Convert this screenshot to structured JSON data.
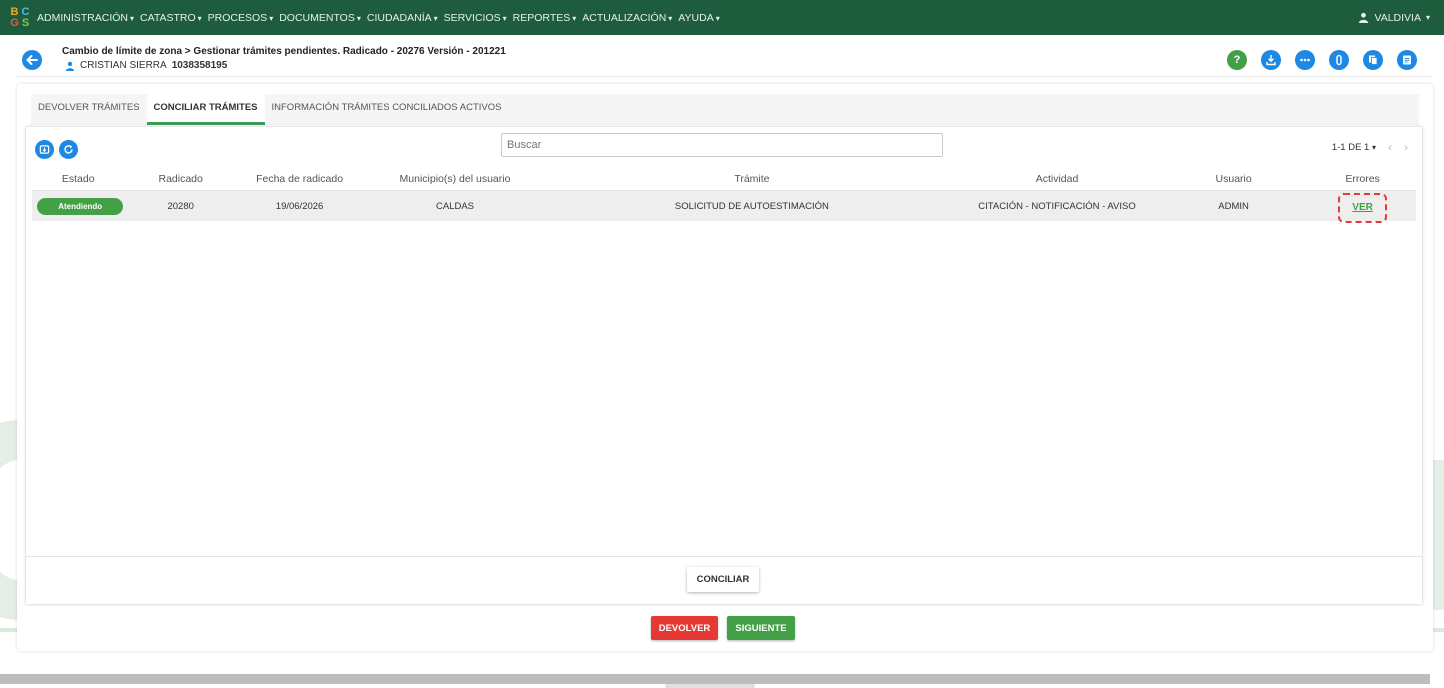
{
  "logo": {
    "letters": [
      "B",
      "C",
      "G",
      "S"
    ]
  },
  "nav": {
    "items": [
      "ADMINISTRACIÓN",
      "CATASTRO",
      "PROCESOS",
      "DOCUMENTOS",
      "CIUDADANÍA",
      "SERVICIOS",
      "REPORTES",
      "ACTUALIZACIÓN",
      "AYUDA"
    ],
    "user": "VALDIVIA",
    "caret": "▾"
  },
  "header": {
    "breadcrumb": "Cambio de límite de zona > Gestionar trámites pendientes. Radicado - 20276 Versión - 201221",
    "person_name": "CRISTIAN SIERRA",
    "person_id": "1038358195",
    "icons": [
      "help-icon",
      "download-icon",
      "more-icon",
      "attachment-icon",
      "copy-icon",
      "notes-icon"
    ]
  },
  "tabs": [
    {
      "label": "DEVOLVER TRÁMITES",
      "active": false
    },
    {
      "label": "CONCILIAR TRÁMITES",
      "active": true
    },
    {
      "label": "INFORMACIÓN TRÁMITES CONCILIADOS ACTIVOS",
      "active": false
    }
  ],
  "toolbar": {
    "search_placeholder": "Buscar",
    "pager_label": "1-1 DE 1",
    "pager_caret": "▾"
  },
  "table": {
    "columns": [
      "Estado",
      "Radicado",
      "Fecha de radicado",
      "Municipio(s) del usuario",
      "Trámite",
      "Actividad",
      "Usuario",
      "Errores"
    ],
    "rows": [
      {
        "estado": "Atendiendo",
        "radicado": "20280",
        "fecha": "19/06/2026",
        "municipio": "CALDAS",
        "tramite": "SOLICITUD DE AUTOESTIMACIÓN",
        "actividad": "CITACIÓN - NOTIFICACIÓN - AVISO",
        "usuario": "ADMIN",
        "errores": "VER"
      }
    ]
  },
  "actions": {
    "conciliar": "CONCILIAR",
    "devolver": "DEVOLVER",
    "siguiente": "SIGUIENTE"
  },
  "colors": {
    "topbar": "#1d5d3d",
    "primary_blue": "#1e88e5",
    "success_green": "#43a047",
    "danger_red": "#e53935"
  }
}
